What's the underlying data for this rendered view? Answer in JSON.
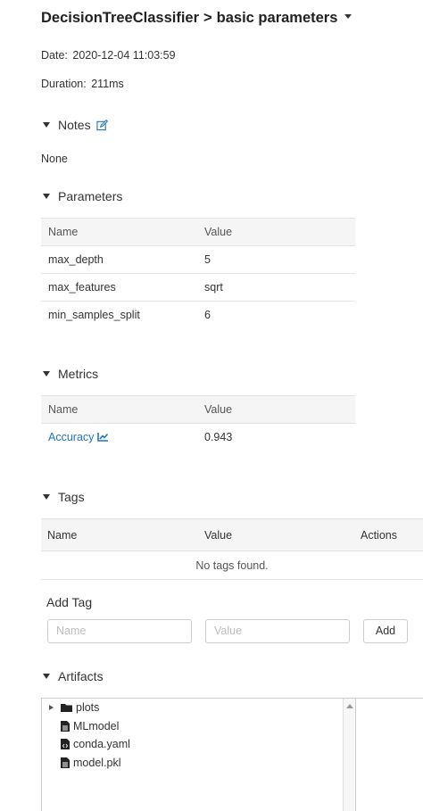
{
  "breadcrumb": {
    "experiment": "DecisionTreeClassifier",
    "separator": ">",
    "run": "basic parameters"
  },
  "meta": {
    "date_label": "Date:",
    "date_value": "2020-12-04 11:03:59",
    "duration_label": "Duration:",
    "duration_value": "211ms"
  },
  "notes": {
    "title": "Notes",
    "content": "None"
  },
  "parameters": {
    "title": "Parameters",
    "columns": [
      "Name",
      "Value"
    ],
    "rows": [
      {
        "name": "max_depth",
        "value": "5"
      },
      {
        "name": "max_features",
        "value": "sqrt"
      },
      {
        "name": "min_samples_split",
        "value": "6"
      }
    ]
  },
  "metrics": {
    "title": "Metrics",
    "columns": [
      "Name",
      "Value"
    ],
    "rows": [
      {
        "name": "Accuracy",
        "value": "0.943"
      }
    ]
  },
  "tags": {
    "title": "Tags",
    "columns": [
      "Name",
      "Value",
      "Actions"
    ],
    "empty_text": "No tags found.",
    "add_title": "Add Tag",
    "name_placeholder": "Name",
    "value_placeholder": "Value",
    "add_button": "Add"
  },
  "artifacts": {
    "title": "Artifacts",
    "items": [
      "plots",
      "MLmodel",
      "conda.yaml",
      "model.pkl"
    ]
  },
  "colors": {
    "link": "#2374bb",
    "header_bg": "#f5f5f5"
  }
}
